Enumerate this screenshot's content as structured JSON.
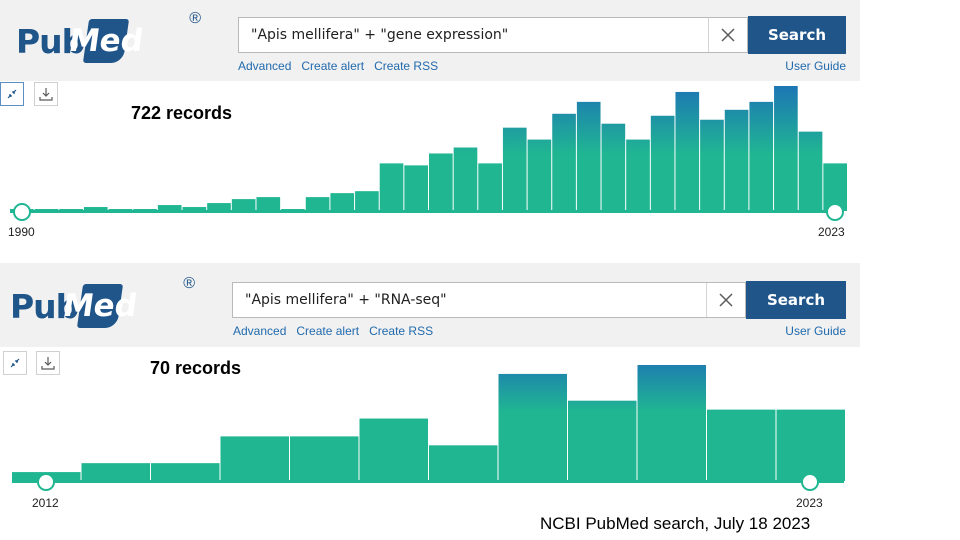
{
  "panels": [
    {
      "logo": {
        "part1": "Pub",
        "part2": "Med",
        "registered": "®"
      },
      "search": {
        "value": "\"Apis mellifera\" + \"gene expression\"",
        "button_label": "Search"
      },
      "links": {
        "advanced": "Advanced",
        "create_alert": "Create alert",
        "create_rss": "Create RSS",
        "user_guide": "User Guide"
      },
      "records": "722 records",
      "timeline": {
        "start": "1990",
        "end": "2023"
      }
    },
    {
      "logo": {
        "part1": "Pub",
        "part2": "Med",
        "registered": "®"
      },
      "search": {
        "value": "\"Apis mellifera\" + \"RNA-seq\"",
        "button_label": "Search"
      },
      "links": {
        "advanced": "Advanced",
        "create_alert": "Create alert",
        "create_rss": "Create RSS",
        "user_guide": "User Guide"
      },
      "records": "70 records",
      "timeline": {
        "start": "2012",
        "end": "2023"
      }
    }
  ],
  "chart_data": [
    {
      "type": "bar",
      "x": [
        1990,
        1991,
        1992,
        1993,
        1994,
        1995,
        1996,
        1997,
        1998,
        1999,
        2000,
        2001,
        2002,
        2003,
        2004,
        2005,
        2006,
        2007,
        2008,
        2009,
        2010,
        2011,
        2012,
        2013,
        2014,
        2015,
        2016,
        2017,
        2018,
        2019,
        2020,
        2021,
        2022,
        2023
      ],
      "values": [
        1,
        1,
        1,
        2,
        1,
        1,
        3,
        2,
        4,
        6,
        7,
        1,
        7,
        9,
        10,
        24,
        23,
        29,
        32,
        24,
        42,
        36,
        49,
        55,
        44,
        36,
        48,
        60,
        46,
        51,
        55,
        63,
        40,
        24
      ],
      "xlim": [
        1990,
        2023
      ]
    },
    {
      "type": "bar",
      "x": [
        2012,
        2013,
        2014,
        2015,
        2016,
        2017,
        2018,
        2019,
        2020,
        2021,
        2022,
        2023
      ],
      "values": [
        1,
        2,
        2,
        5,
        5,
        7,
        4,
        12,
        9,
        13,
        8,
        8
      ],
      "xlim": [
        2012,
        2023
      ]
    }
  ],
  "caption": "NCBI PubMed search, July 18 2023",
  "colors": {
    "brand": "#20558a",
    "link": "#216aad",
    "bar_bottom": "#20b692",
    "bar_top": "#1d74b5"
  },
  "icons": {
    "clear": "close-icon",
    "collapse": "collapse-icon",
    "download": "download-icon"
  }
}
